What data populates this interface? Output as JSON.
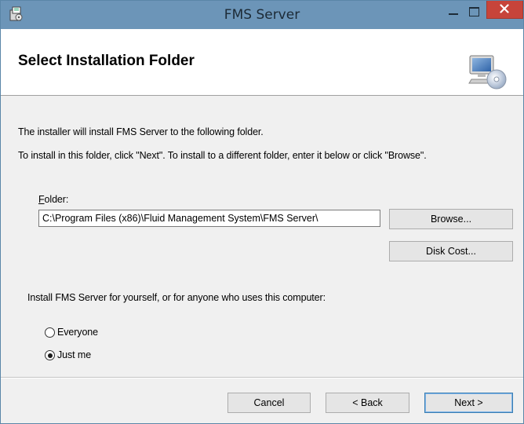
{
  "window": {
    "title": "FMS Server"
  },
  "header": {
    "title": "Select Installation Folder"
  },
  "body": {
    "intro_line1": "The installer will install FMS Server to the following folder.",
    "intro_line2": "To install in this folder, click \"Next\". To install to a different folder, enter it below or click \"Browse\".",
    "folder_label_accel": "F",
    "folder_label_rest": "older:",
    "folder_value": "C:\\Program Files (x86)\\Fluid Management System\\FMS Server\\",
    "browse_label": "Browse...",
    "disk_cost_label": "Disk Cost...",
    "install_for_text": "Install FMS Server for yourself, or for anyone who uses this computer:",
    "radio_options": [
      {
        "label": "Everyone",
        "selected": false
      },
      {
        "label": "Just me",
        "selected": true
      }
    ]
  },
  "footer": {
    "cancel_label": "Cancel",
    "back_label": "< Back",
    "next_label": "Next >"
  },
  "colors": {
    "titlebar": "#6c95b8",
    "close_button": "#c7443a",
    "dialog_background": "#f0f0f0"
  }
}
